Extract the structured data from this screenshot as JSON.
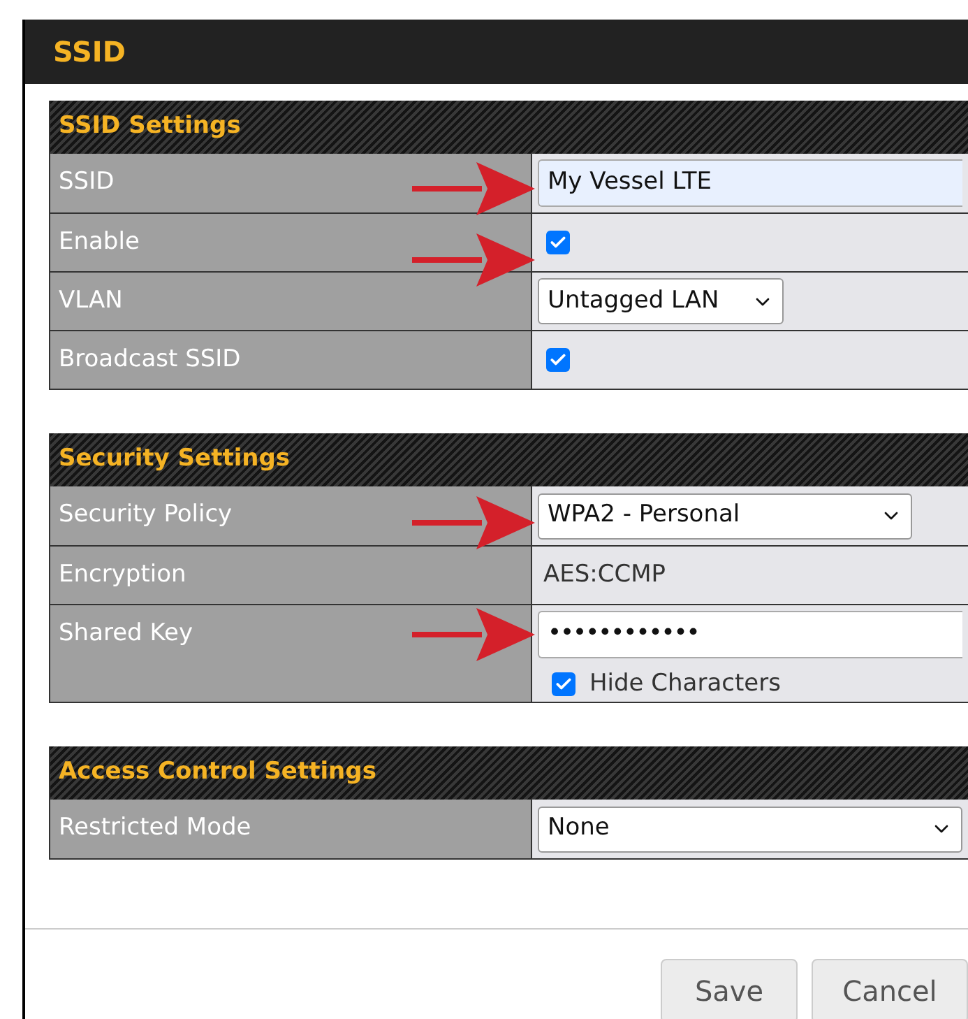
{
  "dialog": {
    "title": "SSID"
  },
  "sections": [
    {
      "title": "SSID Settings",
      "rows": [
        {
          "kind": "text",
          "label": "SSID",
          "value": "My Vessel LTE",
          "arrow": true
        },
        {
          "kind": "checkbox",
          "label": "Enable",
          "checked": true,
          "arrow": true
        },
        {
          "kind": "select",
          "label": "VLAN",
          "value": "Untagged LAN",
          "arrow": false
        },
        {
          "kind": "checkbox",
          "label": "Broadcast SSID",
          "checked": true,
          "arrow": false
        }
      ]
    },
    {
      "title": "Security Settings",
      "rows": [
        {
          "kind": "select",
          "label": "Security Policy",
          "value": "WPA2 - Personal",
          "arrow": true
        },
        {
          "kind": "static",
          "label": "Encryption",
          "value": "AES:CCMP",
          "arrow": false
        },
        {
          "kind": "password",
          "label": "Shared Key",
          "value": "••••••••••••",
          "arrow": true,
          "option": {
            "label": "Hide Characters",
            "checked": true
          }
        }
      ]
    },
    {
      "title": "Access Control Settings",
      "rows": [
        {
          "kind": "select",
          "label": "Restricted Mode",
          "value": "None",
          "arrow": false
        }
      ]
    }
  ],
  "buttons": [
    {
      "label": "Save"
    },
    {
      "label": "Cancel"
    }
  ]
}
